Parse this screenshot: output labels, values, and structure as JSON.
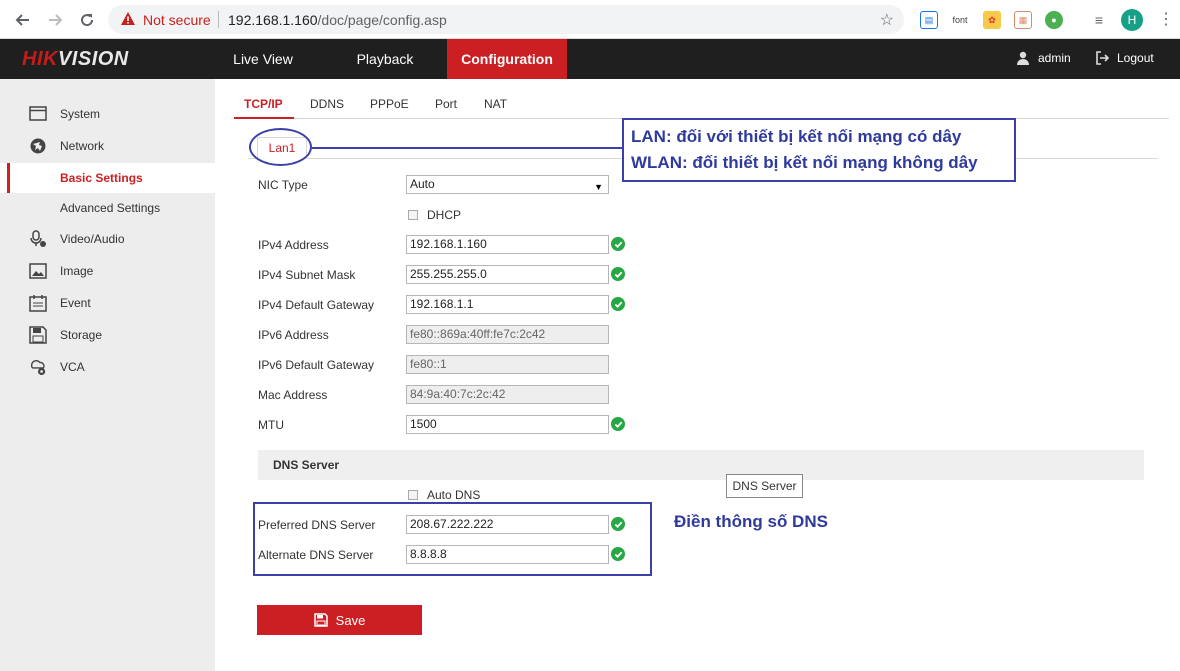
{
  "browser": {
    "security_label": "Not secure",
    "url_host": "192.168.1.160",
    "url_path": "/doc/page/config.asp",
    "ext_font": "font",
    "profile_initial": "H"
  },
  "header": {
    "logo_main": "HIK",
    "logo_rest": "VISION",
    "nav": [
      "Live View",
      "Playback",
      "Configuration"
    ],
    "user": "admin",
    "logout": "Logout"
  },
  "sidebar": {
    "items": [
      {
        "label": "System",
        "icon": "system-icon"
      },
      {
        "label": "Network",
        "icon": "network-icon"
      },
      {
        "label": "Basic Settings",
        "icon": ""
      },
      {
        "label": "Advanced Settings",
        "icon": ""
      },
      {
        "label": "Video/Audio",
        "icon": "video-audio-icon"
      },
      {
        "label": "Image",
        "icon": "image-icon"
      },
      {
        "label": "Event",
        "icon": "event-icon"
      },
      {
        "label": "Storage",
        "icon": "storage-icon"
      },
      {
        "label": "VCA",
        "icon": "vca-icon"
      }
    ]
  },
  "tabs": [
    "TCP/IP",
    "DDNS",
    "PPPoE",
    "Port",
    "NAT"
  ],
  "lan_tab": "Lan1",
  "form": {
    "nic_type_label": "NIC Type",
    "nic_type_value": "Auto",
    "dhcp_label": "DHCP",
    "ipv4_address_label": "IPv4 Address",
    "ipv4_address": "192.168.1.160",
    "ipv4_mask_label": "IPv4 Subnet Mask",
    "ipv4_mask": "255.255.255.0",
    "ipv4_gateway_label": "IPv4 Default Gateway",
    "ipv4_gateway": "192.168.1.1",
    "ipv6_address_label": "IPv6 Address",
    "ipv6_address": "fe80::869a:40ff:fe7c:2c42",
    "ipv6_gateway_label": "IPv6 Default Gateway",
    "ipv6_gateway": "fe80::1",
    "mac_label": "Mac Address",
    "mac": "84:9a:40:7c:2c:42",
    "mtu_label": "MTU",
    "mtu": "1500",
    "dns_section": "DNS Server",
    "auto_dns_label": "Auto DNS",
    "preferred_dns_label": "Preferred DNS Server",
    "preferred_dns": "208.67.222.222",
    "alternate_dns_label": "Alternate DNS Server",
    "alternate_dns": "8.8.8.8",
    "tooltip": "DNS Server",
    "save": "Save"
  },
  "annotations": {
    "lan_note": "LAN: đối với thiết bị kết nối mạng có dây",
    "wlan_note": "WLAN: đối thiết bị kết nối mạng không dây",
    "dns_note": "Điền thông số DNS"
  },
  "colors": {
    "brand_red": "#cc1f23",
    "annotation_blue": "#3b3fa8",
    "ok_green": "#28a745"
  }
}
